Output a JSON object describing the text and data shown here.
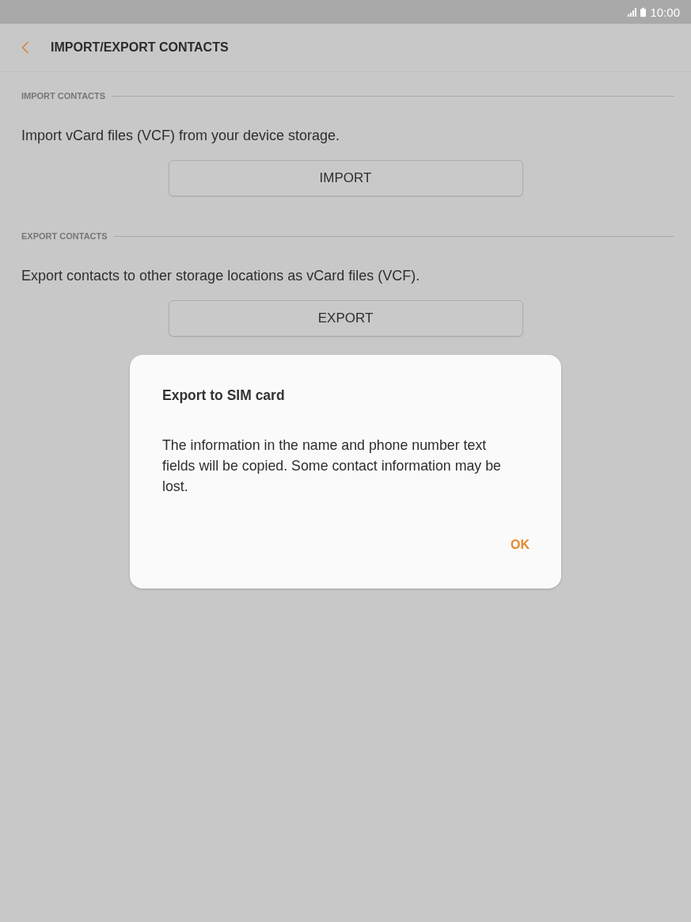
{
  "status_bar": {
    "time": "10:00"
  },
  "header": {
    "title": "IMPORT/EXPORT CONTACTS"
  },
  "sections": [
    {
      "heading": "IMPORT CONTACTS",
      "description": "Import vCard files (VCF) from your device storage.",
      "button": "IMPORT"
    },
    {
      "heading": "EXPORT CONTACTS",
      "description": "Export contacts to other storage locations as vCard files (VCF).",
      "button": "EXPORT"
    }
  ],
  "dialog": {
    "title": "Export to SIM card",
    "message": "The information in the name and phone number text fields will be copied. Some contact information may be lost.",
    "buttons": [
      "OK"
    ]
  }
}
